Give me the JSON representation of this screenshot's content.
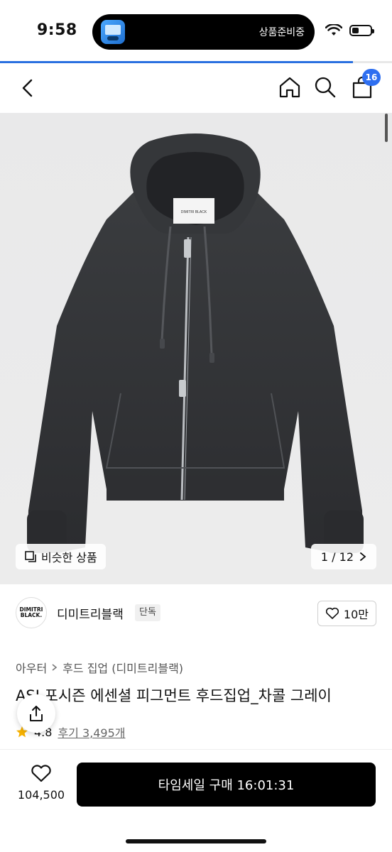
{
  "status_bar": {
    "time": "9:58",
    "island_text": "상품준비중",
    "progress_fraction": 0.9
  },
  "header": {
    "cart_count": "16"
  },
  "image": {
    "similar_label": "비슷한 상품",
    "pager": "1 / 12",
    "label_text": "DIMITRI BLACK"
  },
  "brand": {
    "logo_line1": "DIMITRI",
    "logo_line2": "BLACK.",
    "name": "디미트리블랙",
    "tag": "단독",
    "likes": "10만"
  },
  "product": {
    "breadcrumb": [
      "아우터",
      "후드 집업 (디미트리블랙)"
    ],
    "title": "ASI 포시즌 에센셜 피그먼트 후드집업_차콜 그레이",
    "rating": "4.8",
    "reviews": "후기 3,495개"
  },
  "bottom": {
    "wish_count": "104,500",
    "buy_label": "타임세일 구매 16:01:31"
  }
}
